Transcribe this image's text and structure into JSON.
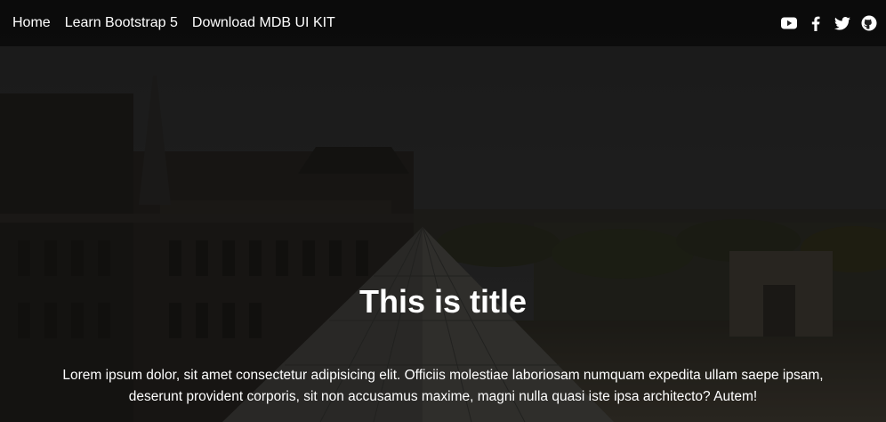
{
  "nav": {
    "links": [
      {
        "label": "Home"
      },
      {
        "label": "Learn Bootstrap 5"
      },
      {
        "label": "Download MDB UI KIT"
      }
    ],
    "icons": [
      "youtube-icon",
      "facebook-icon",
      "twitter-icon",
      "github-icon"
    ]
  },
  "hero": {
    "title": "This is title",
    "description": "Lorem ipsum dolor, sit amet consectetur adipisicing elit. Officiis molestiae laboriosam numquam expedita ullam saepe ipsam, deserunt provident corporis, sit non accusamus maxime, magni nulla quasi iste ipsa architecto? Autem!"
  },
  "colors": {
    "text": "#ffffff",
    "overlay": "#000000"
  }
}
